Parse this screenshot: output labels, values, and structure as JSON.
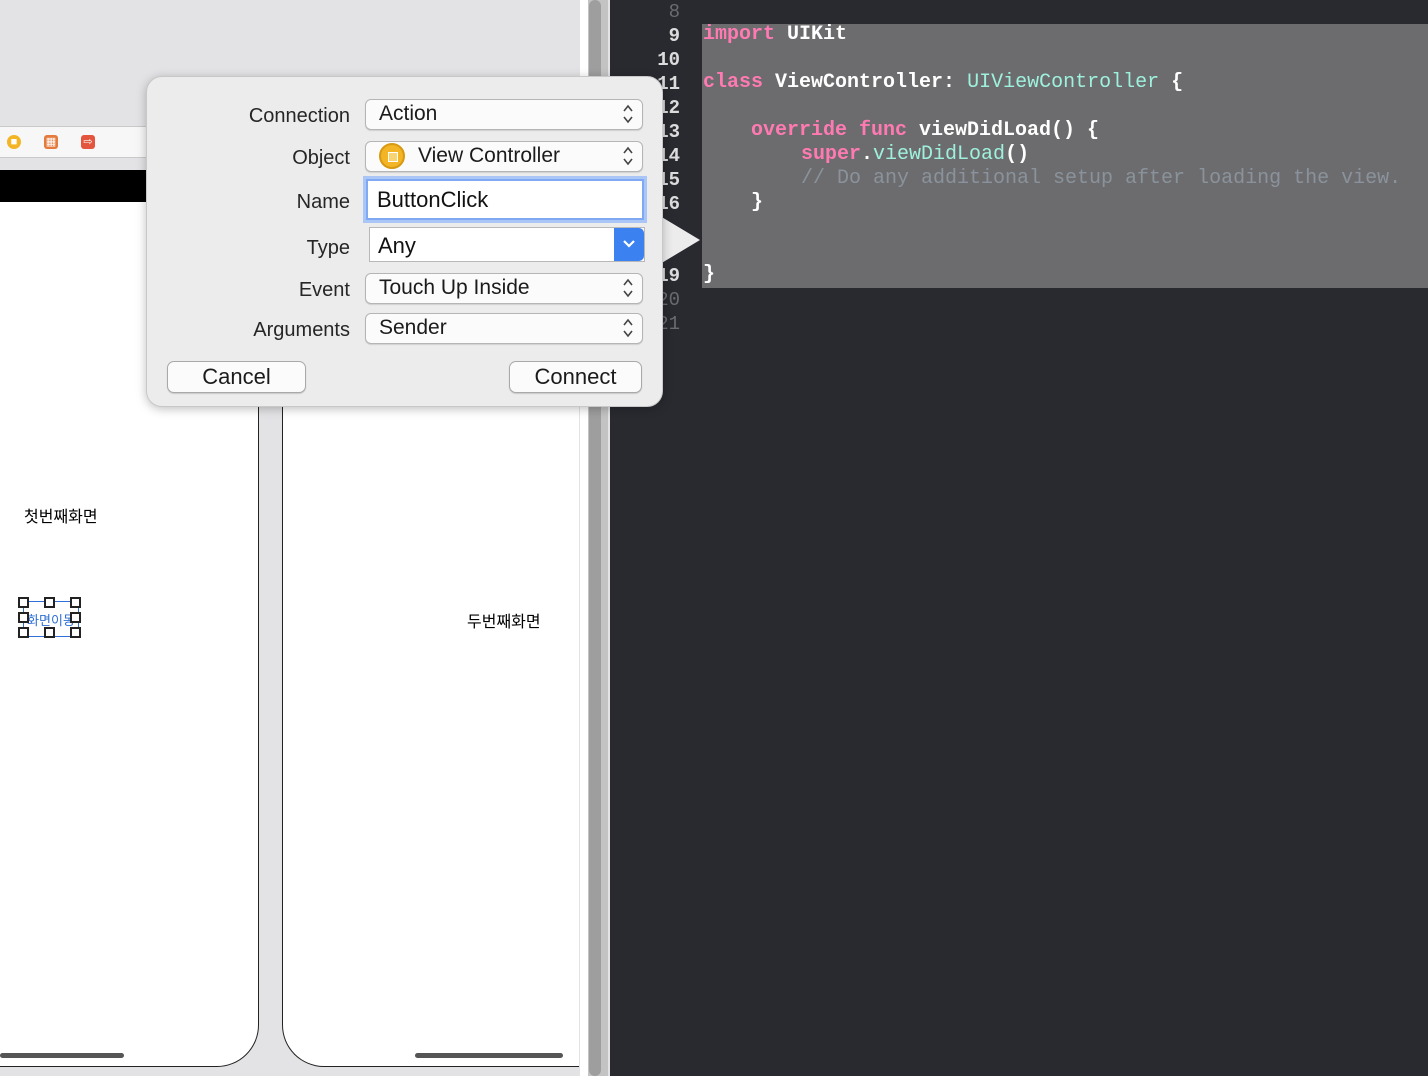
{
  "storyboard": {
    "scene1_label": "첫번째화면",
    "scene2_label": "두번째화면",
    "selected_button_text": "화면이동"
  },
  "editor": {
    "line_numbers": [
      "8",
      "9",
      "10",
      "11",
      "12",
      "13",
      "14",
      "15",
      "16",
      "19",
      "20",
      "21"
    ],
    "lines": {
      "import_kw": "import",
      "import_mod": " UIKit",
      "class_kw": "class",
      "class_name": " ViewController: ",
      "superclass": "UIViewController",
      "class_brace": " {",
      "override_kw": "override",
      "func_kw": " func",
      "func_sig": " viewDidLoad() {",
      "super_kw": "super",
      "super_call_dot": ".",
      "super_call": "viewDidLoad",
      "super_call_end": "()",
      "comment": "// Do any additional setup after loading the view.",
      "close_func": "}",
      "close_class": "}"
    }
  },
  "popover": {
    "connection_label": "Connection",
    "connection_value": "Action",
    "object_label": "Object",
    "object_value": "View Controller",
    "name_label": "Name",
    "name_value": "ButtonClick",
    "type_label": "Type",
    "type_value": "Any",
    "event_label": "Event",
    "event_value": "Touch Up Inside",
    "arguments_label": "Arguments",
    "arguments_value": "Sender",
    "cancel_label": "Cancel",
    "connect_label": "Connect"
  },
  "colors": {
    "editor_bg": "#292a30",
    "keyword": "#ff7ab2",
    "type": "#9ef1dd",
    "comment": "#8a939c",
    "selection": "#6c6c6e",
    "accent": "#3b82f0"
  },
  "icons": [
    "view-controller-icon",
    "first-responder-icon",
    "exit-icon",
    "stepper-icon",
    "chevron-down-icon"
  ]
}
